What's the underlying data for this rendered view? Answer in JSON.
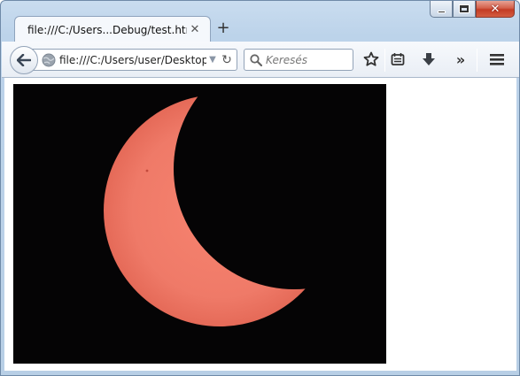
{
  "window": {
    "caption_buttons": {
      "close_label": "✕"
    }
  },
  "tabs": [
    {
      "title": "file:///C:/Users...Debug/test.html",
      "close_icon": "close-icon"
    }
  ],
  "new_tab_label": "+",
  "navbar": {
    "url": "file:///C:/Users/user/Desktop/",
    "search_placeholder": "Keresés"
  },
  "toolbar_icons": [
    "back-arrow-icon",
    "globe-icon",
    "dropdown-icon",
    "reload-icon",
    "search-icon",
    "star-icon",
    "reading-list-icon",
    "download-icon",
    "overflow-icon",
    "menu-icon"
  ],
  "overflow_label": "»",
  "colors": {
    "window_frame": "#bcd3ea",
    "close_button": "#c43b24",
    "image_background": "#050405",
    "sun_color": "#f1796a"
  },
  "content": {
    "image_subject": "partial solar eclipse crescent"
  }
}
